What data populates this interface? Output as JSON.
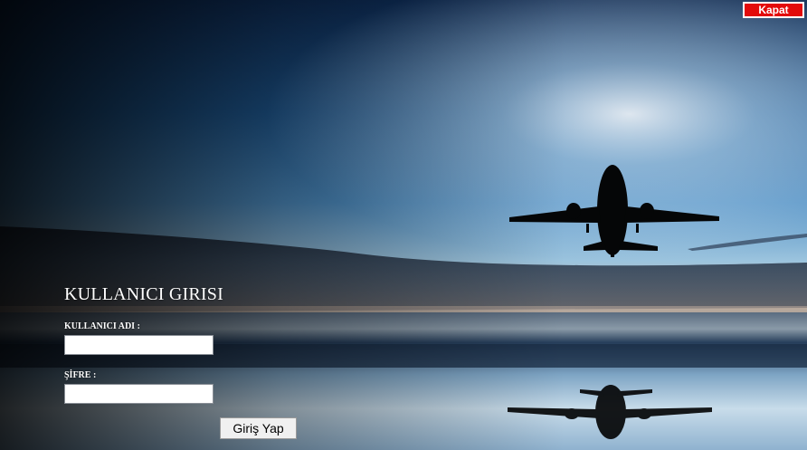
{
  "window": {
    "close_label": "Kapat"
  },
  "login": {
    "title": "KULLANICI GIRISI",
    "username_label": "KULLANICI ADI :",
    "username_value": "",
    "password_label": "ŞİFRE :",
    "password_value": "",
    "submit_label": "Giriş Yap"
  },
  "background": {
    "description_icon": "airplane-over-water-icon"
  },
  "colors": {
    "close_button": "#e30b0b",
    "sky_top": "#0f2f5c",
    "sky_mid": "#3f7fb8",
    "horizon_glow": "#c9b8a6",
    "water": "#2a4a6a"
  }
}
